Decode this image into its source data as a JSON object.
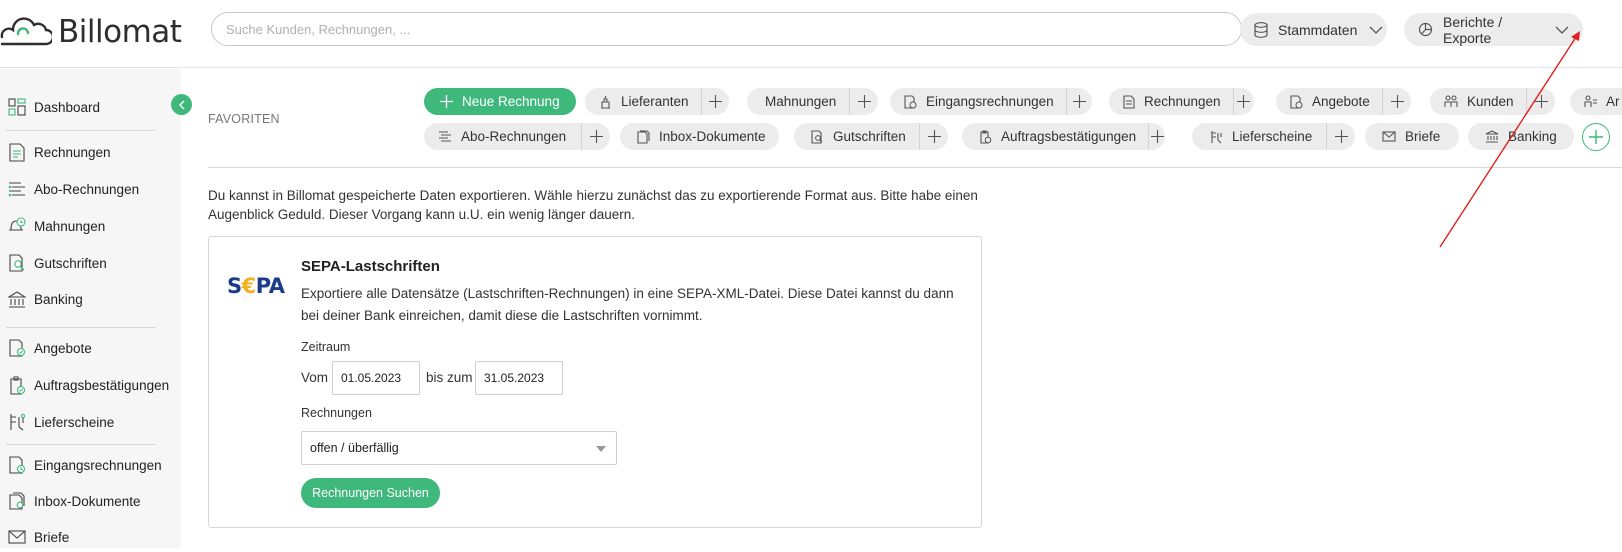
{
  "app": {
    "name": "Billomat"
  },
  "search": {
    "placeholder": "Suche Kunden, Rechnungen, ..."
  },
  "header_buttons": {
    "stammdaten": "Stammdaten",
    "berichte": "Berichte / Exporte"
  },
  "sidebar": {
    "items": [
      {
        "label": "Dashboard",
        "icon": "dashboard-icon"
      },
      {
        "label": "Rechnungen",
        "icon": "invoice-icon"
      },
      {
        "label": "Abo-Rechnungen",
        "icon": "subscription-invoice-icon"
      },
      {
        "label": "Mahnungen",
        "icon": "reminder-icon"
      },
      {
        "label": "Gutschriften",
        "icon": "credit-note-icon"
      },
      {
        "label": "Banking",
        "icon": "bank-icon"
      },
      {
        "label": "Angebote",
        "icon": "offer-icon"
      },
      {
        "label": "Auftragsbestätigungen",
        "icon": "order-confirmation-icon"
      },
      {
        "label": "Lieferscheine",
        "icon": "delivery-note-icon"
      },
      {
        "label": "Eingangsrechnungen",
        "icon": "incoming-invoice-icon"
      },
      {
        "label": "Inbox-Dokumente",
        "icon": "inbox-document-icon"
      },
      {
        "label": "Briefe",
        "icon": "letter-icon"
      }
    ]
  },
  "favorites": {
    "label": "FAVORITEN",
    "row1": [
      "Neue Rechnung",
      "Lieferanten",
      "Mahnungen",
      "Eingangsrechnungen",
      "Rechnungen",
      "Angebote",
      "Kunden",
      "Ar"
    ],
    "row2": [
      "Abo-Rechnungen",
      "Inbox-Dokumente",
      "Gutschriften",
      "Auftragsbestätigungen",
      "Lieferscheine",
      "Briefe",
      "Banking"
    ]
  },
  "main": {
    "intro": "Du kannst in Billomat gespeicherte Daten exportieren. Wähle hierzu zunächst das zu exportierende Format aus. Bitte habe einen Augenblick Geduld. Dieser Vorgang kann u.U. ein wenig länger dauern.",
    "panel": {
      "logo_text_pre": "S",
      "logo_text_euro": "€",
      "logo_text_post": "PA",
      "title": "SEPA-Lastschriften",
      "description": "Exportiere alle Datensätze (Lastschriften-Rechnungen) in eine SEPA-XML-Datei. Diese Datei kannst du dann bei deiner Bank einreichen, damit diese die Lastschriften vornimmt.",
      "zeitraum_label": "Zeitraum",
      "vom_label": "Vom",
      "vom_value": "01.05.2023",
      "bis_label": "bis zum",
      "bis_value": "31.05.2023",
      "rechnungen_label": "Rechnungen",
      "rechnungen_value": "offen / überfällig",
      "search_button": "Rechnungen Suchen"
    }
  },
  "colors": {
    "accent": "#3fb87c",
    "annotation": "#e02020",
    "sepa_blue": "#1a3a8a",
    "sepa_yellow": "#f2b21b"
  }
}
